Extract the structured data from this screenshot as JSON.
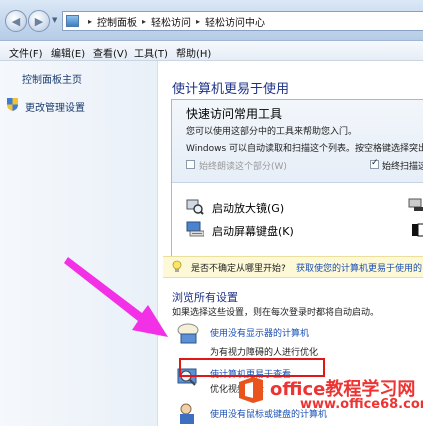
{
  "window": {
    "breadcrumbs": [
      "控制面板",
      "轻松访问",
      "轻松访问中心"
    ]
  },
  "menubar": {
    "items": [
      "文件(F)",
      "编辑(E)",
      "查看(V)",
      "工具(T)",
      "帮助(H)"
    ]
  },
  "sidebar": {
    "items": [
      {
        "label": "控制面板主页"
      },
      {
        "label": "更改管理设置",
        "icon": "shield-icon"
      }
    ]
  },
  "main": {
    "title": "使计算机更易于使用",
    "quick": {
      "title": "快速访问常用工具",
      "desc1": "您可以使用这部分中的工具来帮助您入门。",
      "desc2": "Windows 可以自动读取和扫描这个列表。按空格键选择突出",
      "check1": {
        "label": "始终朗读这个部分(W)",
        "checked": false
      },
      "check2": {
        "label": "始终扫描这",
        "checked": true
      },
      "tools": [
        {
          "label": "启动放大镜(G)",
          "icon": "magnifier-icon"
        },
        {
          "label": "启动屏幕键盘(K)",
          "icon": "keyboard-icon"
        }
      ]
    },
    "tip": {
      "text": "是否不确定从哪里开始?",
      "link": "获取使您的计算机更易于使用的"
    },
    "browse": {
      "title": "浏览所有设置",
      "desc": "如果选择这些设置，则在每次登录时都将自动启动。",
      "items": [
        {
          "link": "使用没有显示器的计算机",
          "sub": "为有视力障碍的人进行优化"
        },
        {
          "link": "使计算机更易于查看",
          "sub": "优化视频显示"
        },
        {
          "link": "使用没有鼠标或键盘的计算机"
        }
      ]
    }
  },
  "watermark": {
    "line1": "office教程学习网",
    "line2": "www.office68.com"
  },
  "colors": {
    "link": "#1a4fb4",
    "heading": "#1e3287",
    "highlight": "#e01717",
    "arrow": "#f230e6"
  }
}
